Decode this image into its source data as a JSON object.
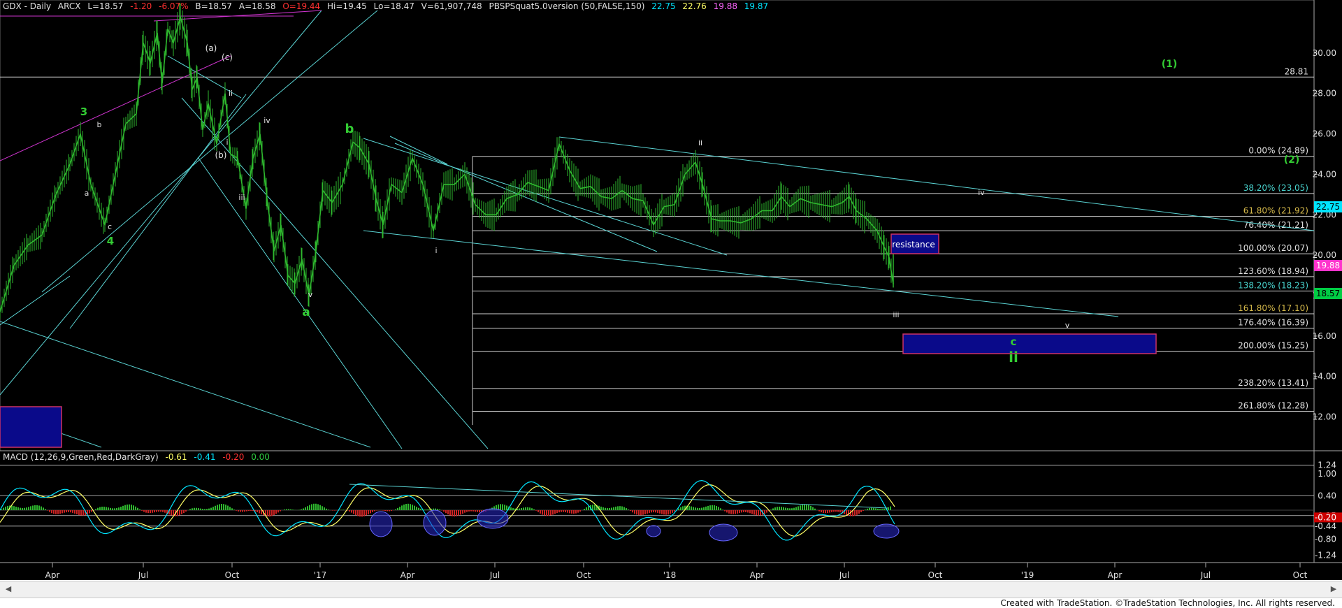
{
  "header": {
    "symbol": "GDX - Daily",
    "exchange": "ARCX",
    "last": "L=18.57",
    "change": "-1.20",
    "change_pct": "-6.07%",
    "bid": "B=18.57",
    "ask": "A=18.58",
    "open": "O=19.44",
    "high": "Hi=19.45",
    "low": "Lo=18.47",
    "volume": "V=61,907,748",
    "study": "PBSPSquat5.0version (50,FALSE,150)",
    "study_vals": [
      "22.75",
      "22.76",
      "19.88",
      "19.87"
    ],
    "colors": {
      "change": "#ff3030",
      "study_vals": [
        "#00e5ff",
        "#ffff66",
        "#ff66ff",
        "#00e5ff"
      ]
    }
  },
  "macd_header": {
    "label": "MACD (12,26,9,Green,Red,DarkGray)",
    "vals": [
      "-0.61",
      "-0.41",
      "-0.20",
      "0.00"
    ],
    "colors": [
      "#ffff66",
      "#00e5ff",
      "#ff3030",
      "#2ecc40"
    ]
  },
  "chart_data": [
    {
      "type": "candlestick",
      "series_name": "GDX - Daily",
      "y_axis_ticks": [
        "12.00",
        "14.00",
        "16.00",
        "18.00",
        "20.00",
        "22.00",
        "24.00",
        "26.00",
        "28.00",
        "30.00"
      ],
      "ylim": [
        10.5,
        32
      ],
      "x_axis_ticks": [
        "Apr",
        "Jul",
        "Oct",
        "'17",
        "Apr",
        "Jul",
        "Oct",
        "'18",
        "Apr",
        "Jul",
        "Oct",
        "'19",
        "Apr",
        "Jul",
        "Oct"
      ],
      "price_path": [
        [
          0,
          17.2
        ],
        [
          20,
          19.5
        ],
        [
          40,
          20.5
        ],
        [
          60,
          21
        ],
        [
          80,
          23
        ],
        [
          100,
          24.5
        ],
        [
          115,
          26
        ],
        [
          130,
          23.5
        ],
        [
          150,
          21.5
        ],
        [
          165,
          24
        ],
        [
          180,
          26.5
        ],
        [
          195,
          27
        ],
        [
          205,
          30.5
        ],
        [
          215,
          29.5
        ],
        [
          225,
          31
        ],
        [
          232,
          28.5
        ],
        [
          240,
          31.2
        ],
        [
          248,
          30.5
        ],
        [
          258,
          31.8
        ],
        [
          268,
          30.5
        ],
        [
          275,
          28.2
        ],
        [
          282,
          28.8
        ],
        [
          290,
          26.2
        ],
        [
          298,
          27.5
        ],
        [
          310,
          25.5
        ],
        [
          322,
          28
        ],
        [
          330,
          25
        ],
        [
          340,
          24.8
        ],
        [
          352,
          22.3
        ],
        [
          362,
          24.8
        ],
        [
          372,
          26
        ],
        [
          382,
          22.8
        ],
        [
          392,
          20.2
        ],
        [
          402,
          21.5
        ],
        [
          412,
          19
        ],
        [
          422,
          18.6
        ],
        [
          432,
          19.8
        ],
        [
          442,
          18
        ],
        [
          452,
          20.2
        ],
        [
          462,
          23.2
        ],
        [
          475,
          22.6
        ],
        [
          490,
          23.5
        ],
        [
          505,
          25.6
        ],
        [
          515,
          25.3
        ],
        [
          528,
          24.5
        ],
        [
          538,
          22.8
        ],
        [
          548,
          21.5
        ],
        [
          560,
          23.5
        ],
        [
          575,
          23.1
        ],
        [
          590,
          24.8
        ],
        [
          605,
          23.5
        ],
        [
          620,
          21.2
        ],
        [
          635,
          23.5
        ],
        [
          650,
          23.5
        ],
        [
          665,
          24
        ],
        [
          680,
          22.5
        ],
        [
          695,
          22
        ],
        [
          710,
          22
        ],
        [
          725,
          22.8
        ],
        [
          740,
          23
        ],
        [
          755,
          23.6
        ],
        [
          770,
          23.4
        ],
        [
          785,
          23.2
        ],
        [
          800,
          25.5
        ],
        [
          815,
          24.2
        ],
        [
          830,
          23.3
        ],
        [
          845,
          23.4
        ],
        [
          860,
          22.9
        ],
        [
          875,
          22.8
        ],
        [
          890,
          23.2
        ],
        [
          905,
          22.8
        ],
        [
          920,
          22.7
        ],
        [
          935,
          21.5
        ],
        [
          950,
          22.4
        ],
        [
          965,
          22.5
        ],
        [
          980,
          24
        ],
        [
          995,
          24.6
        ],
        [
          1005,
          23.5
        ],
        [
          1018,
          21.8
        ],
        [
          1030,
          21.7
        ],
        [
          1045,
          21.7
        ],
        [
          1060,
          21.6
        ],
        [
          1075,
          21.8
        ],
        [
          1090,
          22.2
        ],
        [
          1105,
          22.2
        ],
        [
          1118,
          22.9
        ],
        [
          1130,
          22.4
        ],
        [
          1145,
          22.8
        ],
        [
          1160,
          22.6
        ],
        [
          1175,
          22.5
        ],
        [
          1190,
          22.4
        ],
        [
          1205,
          22.6
        ],
        [
          1215,
          22.9
        ],
        [
          1225,
          22.2
        ],
        [
          1240,
          21.8
        ],
        [
          1255,
          21.2
        ],
        [
          1265,
          20.4
        ],
        [
          1272,
          19.9
        ],
        [
          1278,
          18.57
        ]
      ],
      "annotations": [
        {
          "text": "3",
          "color": "#33cc33"
        },
        {
          "text": "4",
          "color": "#33cc33"
        },
        {
          "text": "a",
          "color": "#33cc33"
        },
        {
          "text": "b",
          "color": "#33cc33"
        },
        {
          "text": "c",
          "color": "#33cc33"
        },
        {
          "text": "ii",
          "color": "#33cc33"
        },
        {
          "text": "(1)",
          "color": "#33cc33"
        },
        {
          "text": "(2)",
          "color": "#33cc33"
        },
        {
          "text": "a",
          "color": "#e0e0e0"
        },
        {
          "text": "b",
          "color": "#e0e0e0"
        },
        {
          "text": "c",
          "color": "#e0e0e0"
        },
        {
          "text": "(a)",
          "color": "#e0e0e0"
        },
        {
          "text": "(b)",
          "color": "#e0e0e0"
        },
        {
          "text": "(c)",
          "color": "#e0e0e0"
        },
        {
          "text": "i",
          "color": "#e0e0e0"
        },
        {
          "text": "ii",
          "color": "#e0e0e0"
        },
        {
          "text": "iii",
          "color": "#e0e0e0"
        },
        {
          "text": "iv",
          "color": "#e0e0e0"
        },
        {
          "text": "v",
          "color": "#e0e0e0"
        },
        {
          "text": "i",
          "color": "#e0e0e0"
        },
        {
          "text": "ii",
          "color": "#e0e0e0"
        },
        {
          "text": "iii",
          "color": "#e0e0e0"
        },
        {
          "text": "iv",
          "color": "#e0e0e0"
        },
        {
          "text": "v",
          "color": "#e0e0e0"
        },
        {
          "text": "resistance",
          "color": "#ffffff"
        }
      ],
      "horizontal_levels": [
        {
          "price": 28.81,
          "label": "28.81",
          "color": "#e0e0e0"
        },
        {
          "price": 24.89,
          "label": "0.00% (24.89)",
          "color": "#e0e0e0"
        },
        {
          "price": 23.05,
          "label": "38.20% (23.05)",
          "color": "#48d1cc"
        },
        {
          "price": 21.92,
          "label": "61.80% (21.92)",
          "color": "#d4b84a"
        },
        {
          "price": 21.21,
          "label": "76.40% (21.21)",
          "color": "#e0e0e0"
        },
        {
          "price": 20.07,
          "label": "100.00% (20.07)",
          "color": "#e0e0e0"
        },
        {
          "price": 18.94,
          "label": "123.60% (18.94)",
          "color": "#e0e0e0"
        },
        {
          "price": 18.23,
          "label": "138.20% (18.23)",
          "color": "#48d1cc"
        },
        {
          "price": 17.1,
          "label": "161.80% (17.10)",
          "color": "#d4b84a"
        },
        {
          "price": 16.39,
          "label": "176.40% (16.39)",
          "color": "#e0e0e0"
        },
        {
          "price": 15.25,
          "label": "200.00% (15.25)",
          "color": "#e0e0e0"
        },
        {
          "price": 13.41,
          "label": "238.20% (13.41)",
          "color": "#e0e0e0"
        },
        {
          "price": 12.28,
          "label": "261.80% (12.28)",
          "color": "#e0e0e0"
        }
      ],
      "price_badges": [
        {
          "value": "22.75",
          "bg": "#00e5ff",
          "fg": "#000"
        },
        {
          "value": "19.88",
          "bg": "#ff33cc",
          "fg": "#fff"
        },
        {
          "value": "18.57",
          "bg": "#00cc44",
          "fg": "#000"
        }
      ]
    },
    {
      "type": "macd",
      "y_axis_ticks": [
        "1.24",
        "1.00",
        "0.40",
        "-0.15",
        "-0.20",
        "-0.44",
        "-0.80",
        "-1.24"
      ],
      "ylim": [
        -1.35,
        1.35
      ]
    }
  ],
  "footer": {
    "copyright": "Created with TradeStation. ©TradeStation Technologies, Inc. All rights reserved."
  }
}
